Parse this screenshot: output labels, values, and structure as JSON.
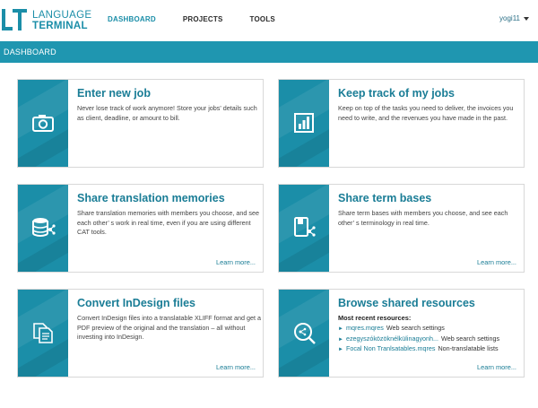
{
  "header": {
    "logo_line1": "LANGUAGE",
    "logo_line2": "TERMINAL",
    "nav": [
      {
        "label": "DASHBOARD",
        "active": true
      },
      {
        "label": "PROJECTS",
        "active": false
      },
      {
        "label": "TOOLS",
        "active": false
      }
    ],
    "user": "yogi11"
  },
  "titlebar": {
    "label": "DASHBOARD"
  },
  "cards": {
    "enter_job": {
      "title": "Enter new job",
      "text": "Never lose track of work anymore! Store your jobs' details such as client, deadline, or amount to bill.",
      "icon": "camera-icon"
    },
    "track_jobs": {
      "title": "Keep track of my jobs",
      "text": "Keep on top of the tasks you need to deliver, the invoices you need to write, and the revenues you have made in the past.",
      "icon": "chart-icon"
    },
    "share_tm": {
      "title": "Share translation memories",
      "text": "Share translation memories with members you choose, and see each other’ s work in real time, even if you are using different CAT tools.",
      "more": "Learn more...",
      "icon": "database-share-icon"
    },
    "share_tb": {
      "title": "Share term bases",
      "text": "Share term bases with members you choose, and see each other’ s terminology in real time.",
      "more": "Learn more...",
      "icon": "termbase-share-icon"
    },
    "indesign": {
      "title": "Convert InDesign files",
      "text": "Convert InDesign files into a translatable XLIFF format and get a PDF preview of the original and the translation – all without investing into InDesign.",
      "more": "Learn more...",
      "icon": "documents-icon"
    },
    "browse": {
      "title": "Browse shared resources",
      "recent_title": "Most recent resources:",
      "items": [
        {
          "link": "mqres.mqres",
          "type": "Web search settings"
        },
        {
          "link": "ezegyszóközöknélkülinagyonh...",
          "type": "Web search settings"
        },
        {
          "link": "Focal Non Tranlsatables.mqres",
          "type": "Non-translatable lists"
        }
      ],
      "more": "Learn more...",
      "icon": "search-share-icon"
    }
  },
  "colors": {
    "accent": "#1b8ea8",
    "titlebar": "#1f96b0"
  }
}
